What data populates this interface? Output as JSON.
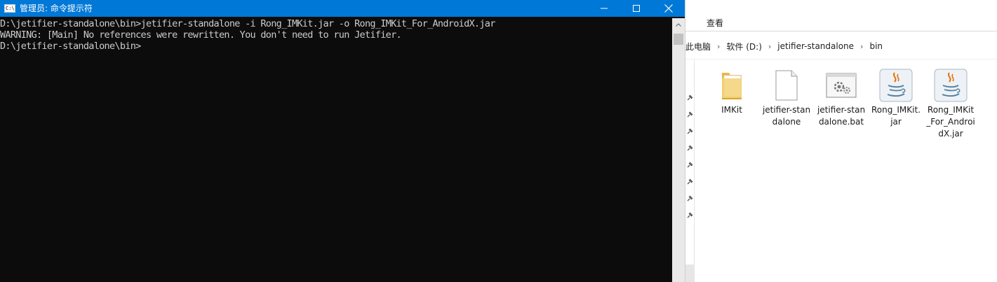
{
  "console": {
    "title": "管理员: 命令提示符",
    "title_icon_text": "C:\\",
    "lines": [
      "D:\\jetifier-standalone\\bin>jetifier-standalone -i Rong_IMKit.jar -o Rong_IMKit_For_AndroidX.jar",
      "WARNING: [Main] No references were rewritten. You don't need to run Jetifier.",
      "D:\\jetifier-standalone\\bin>"
    ]
  },
  "explorer": {
    "ribbon_tab": "查看",
    "breadcrumbs": [
      "此电脑",
      "软件 (D:)",
      "jetifier-standalone",
      "bin"
    ],
    "files": [
      {
        "name": "IMKit",
        "type": "folder"
      },
      {
        "name": "jetifier-standalone",
        "type": "file"
      },
      {
        "name": "jetifier-standalone.bat",
        "type": "batch"
      },
      {
        "name": "Rong_IMKit.jar",
        "type": "jar"
      },
      {
        "name": "Rong_IMKit_For_AndroidX.jar",
        "type": "jar"
      }
    ]
  },
  "colors": {
    "titlebar": "#0078d7",
    "console_bg": "#0c0c0c",
    "console_text": "#cccccc",
    "java_orange": "#e76f00",
    "java_blue": "#5382a1"
  },
  "icons": {
    "minimize": "minimize-icon",
    "maximize": "maximize-icon",
    "close": "close-icon",
    "breadcrumb_separator": "chevron-right-icon",
    "pin": "pin-icon"
  }
}
